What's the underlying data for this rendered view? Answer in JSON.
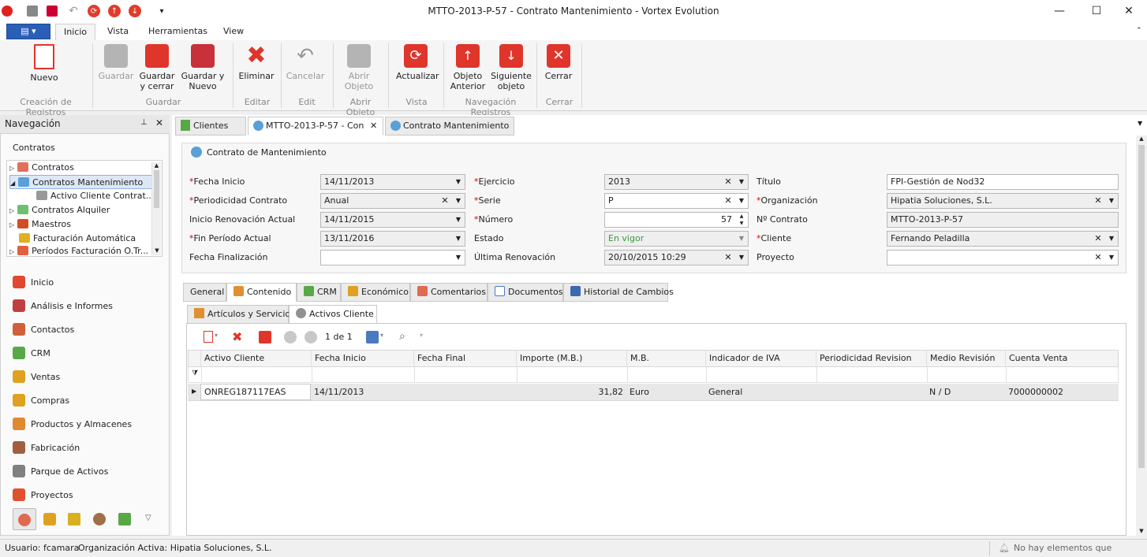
{
  "window": {
    "title": "MTTO-2013-P-57 - Contrato Mantenimiento - Vortex Evolution",
    "minimize": "—",
    "maximize": "☐",
    "close": "✕"
  },
  "quick_access": {
    "more": "▾"
  },
  "menu": {
    "app_button": "▤ ▾",
    "tabs": [
      "Inicio",
      "Vista",
      "Herramientas",
      "View"
    ]
  },
  "ribbon": {
    "buttons": {
      "nuevo": "Nuevo",
      "guardar": "Guardar",
      "guardar_cerrar": "Guardar y cerrar",
      "guardar_nuevo": "Guardar y Nuevo",
      "eliminar": "Eliminar",
      "cancelar": "Cancelar",
      "abrir_objeto": "Abrir Objeto",
      "actualizar": "Actualizar",
      "objeto_anterior": "Objeto Anterior",
      "siguiente_objeto": "Siguiente objeto",
      "cerrar": "Cerrar"
    },
    "groups": [
      "Creación de Registros",
      "Guardar",
      "Editar",
      "Edit",
      "Abrir Objeto",
      "Vista",
      "Navegación Registros",
      "Cerrar"
    ]
  },
  "navigation": {
    "title": "Navegación",
    "section": "Contratos",
    "tree": [
      "Contratos",
      "Contratos Mantenimiento",
      "Activo Cliente Contrat...",
      "Contratos Alquiler",
      "Maestros",
      "Facturación Automática",
      "Períodos Facturación O.Tr..."
    ],
    "items": [
      "Inicio",
      "Análisis e Informes",
      "Contactos",
      "CRM",
      "Ventas",
      "Compras",
      "Productos y Almacenes",
      "Fabricación",
      "Parque de Activos",
      "Proyectos"
    ]
  },
  "doc_tabs": [
    "Clientes",
    "MTTO-2013-P-57 - Con",
    "Contrato Mantenimiento"
  ],
  "form": {
    "header": "Contrato de Mantenimiento",
    "fecha_inicio": {
      "label": "Fecha Inicio",
      "value": "14/11/2013"
    },
    "periodicidad": {
      "label": "Periodicidad Contrato",
      "value": "Anual"
    },
    "inicio_renovacion": {
      "label": "Inicio Renovación Actual",
      "value": "14/11/2015"
    },
    "fin_periodo": {
      "label": "Fin Período Actual",
      "value": "13/11/2016"
    },
    "fecha_finalizacion": {
      "label": "Fecha Finalización",
      "value": ""
    },
    "ejercicio": {
      "label": "Ejercicio",
      "value": "2013"
    },
    "serie": {
      "label": "Serie",
      "value": "P"
    },
    "numero": {
      "label": "Número",
      "value": "57"
    },
    "estado": {
      "label": "Estado",
      "value": "En vigor"
    },
    "ultima_renovacion": {
      "label": "Última Renovación",
      "value": "20/10/2015 10:29"
    },
    "titulo": {
      "label": "Título",
      "value": "FPI-Gestión de Nod32"
    },
    "organizacion": {
      "label": "Organización",
      "value": "Hipatia Soluciones, S.L."
    },
    "n_contrato": {
      "label": "Nº Contrato",
      "value": "MTTO-2013-P-57"
    },
    "cliente": {
      "label": "Cliente",
      "value": "Fernando Peladilla"
    },
    "proyecto": {
      "label": "Proyecto",
      "value": ""
    }
  },
  "content_tabs": [
    "General",
    "Contenido",
    "CRM",
    "Económico",
    "Comentarios",
    "Documentos",
    "Historial de Cambios"
  ],
  "sub_tabs": [
    "Artículos y Servicios",
    "Activos Cliente"
  ],
  "grid": {
    "pager": "1 de 1",
    "columns": [
      "Activo Cliente",
      "Fecha Inicio",
      "Fecha Final",
      "Importe (M.B.)",
      "M.B.",
      "Indicador de IVA",
      "Periodicidad Revision",
      "Medio Revisión",
      "Cuenta Venta"
    ],
    "rows": [
      [
        "ONREG187117EAS",
        "14/11/2013",
        "",
        "31,82",
        "Euro",
        "General",
        "",
        "N / D",
        "7000000002"
      ]
    ]
  },
  "status": {
    "user": "Usuario: fcamara",
    "org": "Organización Activa: Hipatia Soluciones, S.L.",
    "notifications": "No hay elementos que mostrar"
  }
}
